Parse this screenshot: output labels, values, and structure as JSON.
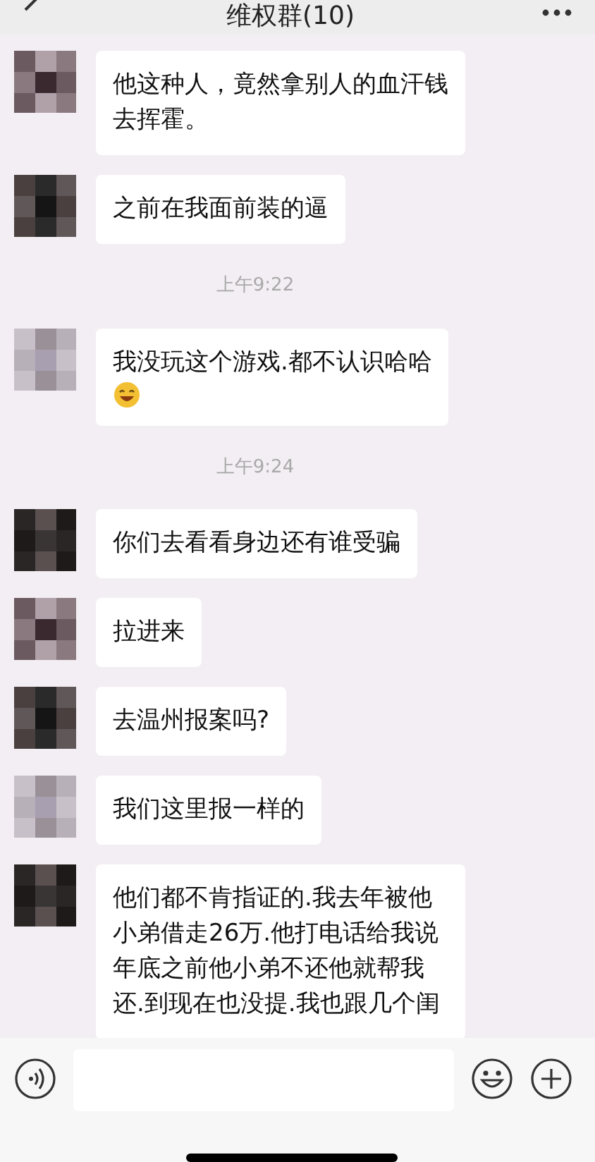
{
  "header": {
    "title": "维权群(10)"
  },
  "messages": [
    {
      "kind": "message",
      "text": "他这种人，竟然拿别人的血汗钱去挥霍。",
      "emoji": false
    },
    {
      "kind": "message",
      "text": "之前在我面前装的逼",
      "emoji": false
    },
    {
      "kind": "time",
      "text": "上午9:22"
    },
    {
      "kind": "message",
      "text": "我没玩这个游戏.都不认识哈哈",
      "emoji": true
    },
    {
      "kind": "time",
      "text": "上午9:24"
    },
    {
      "kind": "message",
      "text": "你们去看看身边还有谁受骗",
      "emoji": false
    },
    {
      "kind": "message",
      "text": "拉进来",
      "emoji": false
    },
    {
      "kind": "message",
      "text": "去温州报案吗?",
      "emoji": false
    },
    {
      "kind": "message",
      "text": "我们这里报一样的",
      "emoji": false
    },
    {
      "kind": "message",
      "text": "他们都不肯指证的.我去年被他小弟借走26万.他打电话给我说年底之前他小弟不还他就帮我还.到现在也没提.我也跟几个闺",
      "emoji": false
    }
  ]
}
